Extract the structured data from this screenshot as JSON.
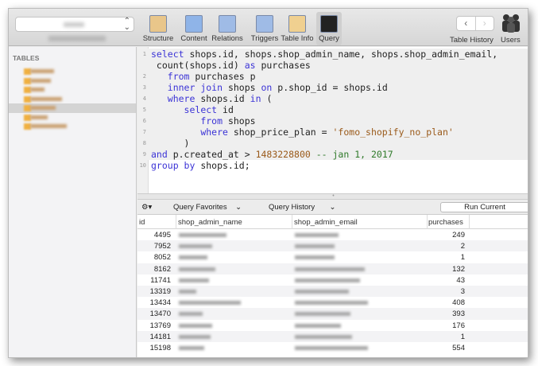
{
  "toolbar": {
    "items": [
      {
        "label": "Structure",
        "icon": "structure-icon"
      },
      {
        "label": "Content",
        "icon": "content-icon"
      },
      {
        "label": "Relations",
        "icon": "relations-icon"
      },
      {
        "label": "Triggers",
        "icon": "triggers-icon"
      },
      {
        "label": "Table Info",
        "icon": "table-info-icon"
      },
      {
        "label": "Query",
        "icon": "query-icon"
      }
    ],
    "active": "Query",
    "table_history": "Table History",
    "users": "Users",
    "back": "‹",
    "forward": "›"
  },
  "sidebar": {
    "header": "TABLES",
    "selected_index": 5
  },
  "editor": {
    "lines": [
      {
        "n": "1",
        "tokens": [
          [
            "kw",
            "select"
          ],
          [
            "id",
            " shops.id, shops.shop_admin_name, shops.shop_admin_email,"
          ]
        ]
      },
      {
        "n": "",
        "tokens": [
          [
            "id",
            " count(shops.id) "
          ],
          [
            "kw",
            "as"
          ],
          [
            "id",
            " purchases"
          ]
        ]
      },
      {
        "n": "2",
        "tokens": [
          [
            "id",
            "   "
          ],
          [
            "kw",
            "from"
          ],
          [
            "id",
            " purchases p"
          ]
        ]
      },
      {
        "n": "3",
        "tokens": [
          [
            "id",
            "   "
          ],
          [
            "kw",
            "inner join"
          ],
          [
            "id",
            " shops "
          ],
          [
            "kw",
            "on"
          ],
          [
            "id",
            " p.shop_id = shops.id"
          ]
        ]
      },
      {
        "n": "4",
        "tokens": [
          [
            "id",
            "   "
          ],
          [
            "kw",
            "where"
          ],
          [
            "id",
            " shops.id "
          ],
          [
            "kw",
            "in"
          ],
          [
            "id",
            " ("
          ]
        ]
      },
      {
        "n": "5",
        "tokens": [
          [
            "id",
            "      "
          ],
          [
            "kw",
            "select"
          ],
          [
            "id",
            " id"
          ]
        ]
      },
      {
        "n": "6",
        "tokens": [
          [
            "id",
            "         "
          ],
          [
            "kw",
            "from"
          ],
          [
            "id",
            " shops"
          ]
        ]
      },
      {
        "n": "7",
        "tokens": [
          [
            "id",
            "         "
          ],
          [
            "kw",
            "where"
          ],
          [
            "id",
            " shop_price_plan = "
          ],
          [
            "str",
            "'fomo_shopify_no_plan'"
          ]
        ]
      },
      {
        "n": "8",
        "tokens": [
          [
            "id",
            "      )"
          ]
        ]
      },
      {
        "n": "9",
        "tokens": [
          [
            "kw",
            "and"
          ],
          [
            "id",
            " p.created_at > "
          ],
          [
            "num",
            "1483228800"
          ],
          [
            "cm",
            " -- jan 1, 2017"
          ]
        ]
      },
      {
        "n": "10",
        "tokens": [
          [
            "kw",
            "group by"
          ],
          [
            "id",
            " shops.id;"
          ]
        ]
      }
    ]
  },
  "query_bar": {
    "favorites": "Query Favorites",
    "history": "Query History",
    "run": "Run Current"
  },
  "results": {
    "columns": [
      "id",
      "shop_admin_name",
      "shop_admin_email",
      "purchases"
    ],
    "rows": [
      {
        "id": "4495",
        "purchases": "249"
      },
      {
        "id": "7952",
        "purchases": "2"
      },
      {
        "id": "8052",
        "purchases": "1"
      },
      {
        "id": "8162",
        "purchases": "132"
      },
      {
        "id": "11741",
        "purchases": "43"
      },
      {
        "id": "13319",
        "purchases": "3"
      },
      {
        "id": "13434",
        "purchases": "408"
      },
      {
        "id": "13470",
        "purchases": "393"
      },
      {
        "id": "13769",
        "purchases": "176"
      },
      {
        "id": "14181",
        "purchases": "1"
      },
      {
        "id": "15198",
        "purchases": "554"
      }
    ]
  }
}
